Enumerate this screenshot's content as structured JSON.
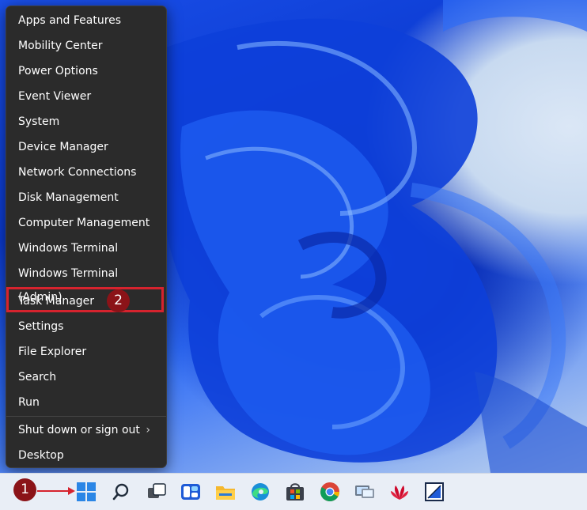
{
  "menu": {
    "items": [
      {
        "label": "Apps and Features"
      },
      {
        "label": "Mobility Center"
      },
      {
        "label": "Power Options"
      },
      {
        "label": "Event Viewer"
      },
      {
        "label": "System"
      },
      {
        "label": "Device Manager"
      },
      {
        "label": "Network Connections"
      },
      {
        "label": "Disk Management"
      },
      {
        "label": "Computer Management"
      },
      {
        "label": "Windows Terminal"
      },
      {
        "label": "Windows Terminal (Admin)"
      },
      {
        "label": "Task Manager"
      },
      {
        "label": "Settings"
      },
      {
        "label": "File Explorer"
      },
      {
        "label": "Search"
      },
      {
        "label": "Run"
      },
      {
        "label": "Shut down or sign out"
      },
      {
        "label": "Desktop"
      }
    ]
  },
  "annotations": {
    "step1": "1",
    "step2": "2",
    "highlight_color": "#d6232e"
  },
  "taskbar": {
    "icons": [
      "windows-start-icon",
      "search-icon",
      "task-view-icon",
      "widgets-icon",
      "file-explorer-icon",
      "edge-icon",
      "microsoft-store-icon",
      "chrome-icon",
      "remote-desktop-icon",
      "huawei-icon",
      "notepad-icon"
    ]
  }
}
